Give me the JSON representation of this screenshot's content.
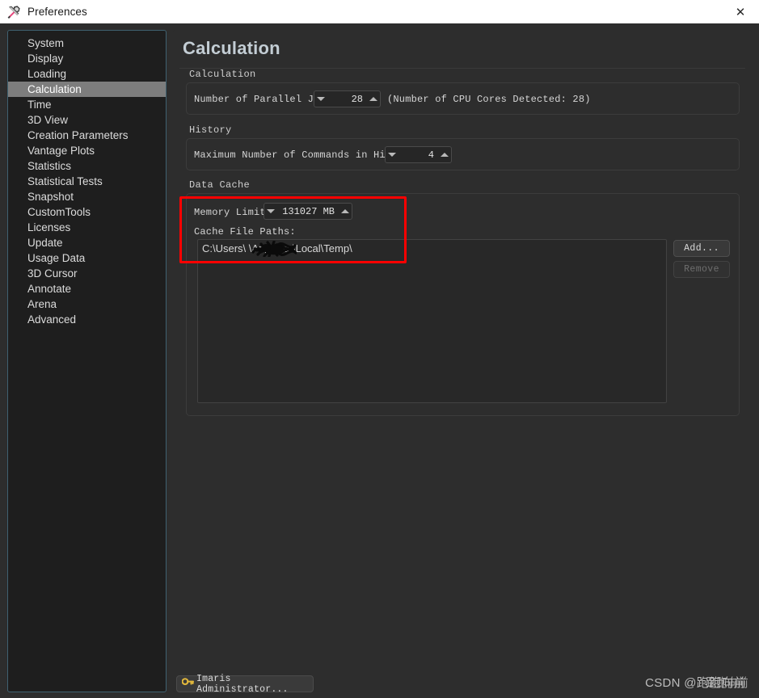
{
  "window": {
    "title": "Preferences",
    "icon": "tools-icon",
    "close_label": "✕"
  },
  "sidebar": {
    "items": [
      {
        "label": "System",
        "selected": false
      },
      {
        "label": "Display",
        "selected": false
      },
      {
        "label": "Loading",
        "selected": false
      },
      {
        "label": "Calculation",
        "selected": true
      },
      {
        "label": "Time",
        "selected": false
      },
      {
        "label": "3D View",
        "selected": false
      },
      {
        "label": "Creation Parameters",
        "selected": false
      },
      {
        "label": "Vantage Plots",
        "selected": false
      },
      {
        "label": "Statistics",
        "selected": false
      },
      {
        "label": "Statistical Tests",
        "selected": false
      },
      {
        "label": "Snapshot",
        "selected": false
      },
      {
        "label": "CustomTools",
        "selected": false
      },
      {
        "label": "Licenses",
        "selected": false
      },
      {
        "label": "Update",
        "selected": false
      },
      {
        "label": "Usage Data",
        "selected": false
      },
      {
        "label": "3D Cursor",
        "selected": false
      },
      {
        "label": "Annotate",
        "selected": false
      },
      {
        "label": "Arena",
        "selected": false
      },
      {
        "label": "Advanced",
        "selected": false
      }
    ]
  },
  "main": {
    "page_title": "Calculation",
    "calculation": {
      "section_label": "Calculation",
      "parallel_jobs_label": "Number of Parallel Jobs:",
      "parallel_jobs_value": "28",
      "cpu_cores_note": "(Number of CPU Cores Detected: 28)"
    },
    "history": {
      "section_label": "History",
      "max_commands_label": "Maximum Number of Commands in History:",
      "max_commands_value": "4"
    },
    "data_cache": {
      "section_label": "Data Cache",
      "memory_limit_label": "Memory Limit:",
      "memory_limit_value": "131027 MB",
      "cache_paths_label": "Cache File Paths:",
      "paths": [
        "C:\\Users\\            \\AppData\\Local\\Temp\\"
      ],
      "add_button": "Add...",
      "remove_button": "Remove",
      "highlight_color": "#fe0000"
    }
  },
  "footer": {
    "admin_button": "Imaris Administrator...",
    "admin_icon": "key-icon",
    "watermark": "CSDN @跑跑向前",
    "watermark_prefix": "CSDN @",
    "watermark_name": "跑跑向前"
  }
}
